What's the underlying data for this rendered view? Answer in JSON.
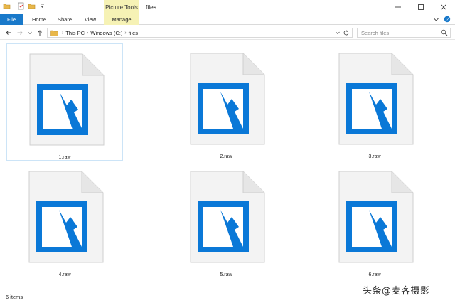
{
  "window": {
    "title": "files",
    "context_tab": "Picture Tools"
  },
  "ribbon": {
    "tabs": {
      "file": "File",
      "home": "Home",
      "share": "Share",
      "view": "View",
      "manage": "Manage"
    }
  },
  "address": {
    "crumbs": [
      "This PC",
      "Windows (C:)",
      "files"
    ]
  },
  "search": {
    "placeholder": "Search files"
  },
  "files": [
    {
      "name": "1.raw"
    },
    {
      "name": "2.raw"
    },
    {
      "name": "3.raw"
    },
    {
      "name": "4.raw"
    },
    {
      "name": "5.raw"
    },
    {
      "name": "6.raw"
    }
  ],
  "status": {
    "item_count": "6 items"
  },
  "watermark": "头条@麦客摄影",
  "colors": {
    "accent": "#1979ca",
    "context": "#f6f2b5",
    "picture_blue": "#0a78d7"
  },
  "icons": {
    "file_icon": "picture-file-icon"
  }
}
